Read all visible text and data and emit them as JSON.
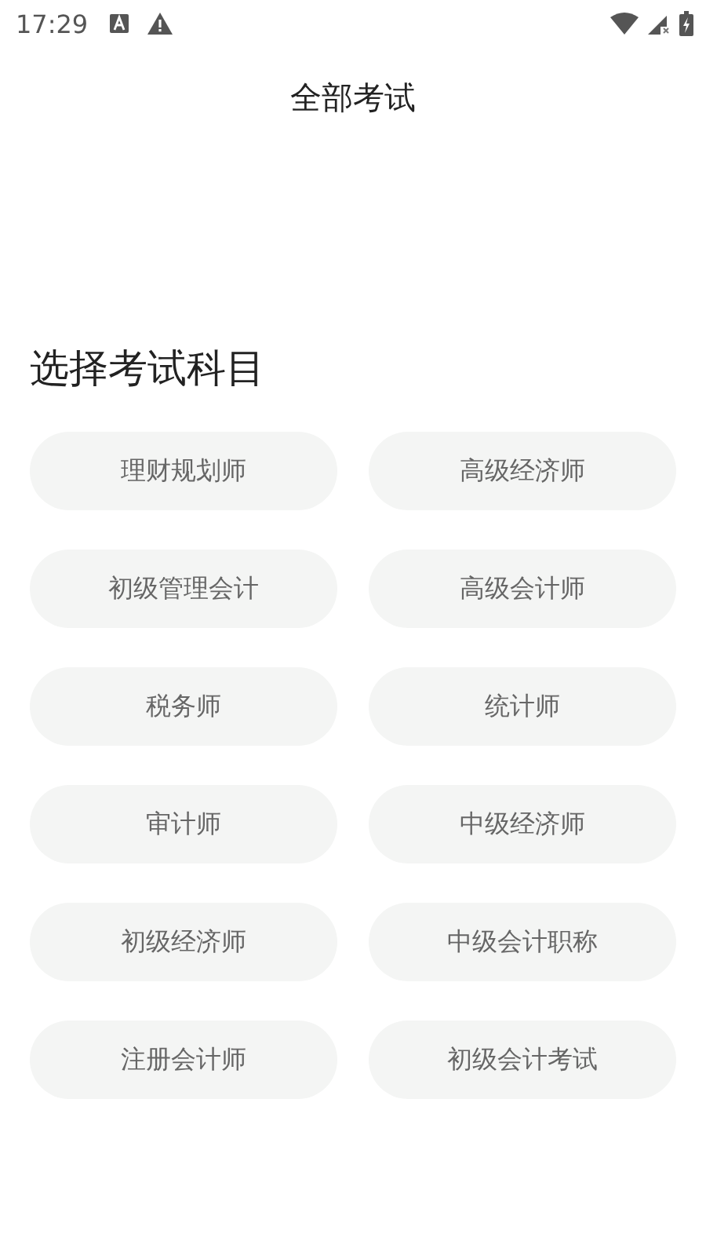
{
  "status_bar": {
    "time": "17:29"
  },
  "header": {
    "title": "全部考试"
  },
  "section": {
    "title": "选择考试科目"
  },
  "subjects": [
    {
      "label": "理财规划师"
    },
    {
      "label": "高级经济师"
    },
    {
      "label": "初级管理会计"
    },
    {
      "label": "高级会计师"
    },
    {
      "label": "税务师"
    },
    {
      "label": "统计师"
    },
    {
      "label": "审计师"
    },
    {
      "label": "中级经济师"
    },
    {
      "label": "初级经济师"
    },
    {
      "label": "中级会计职称"
    },
    {
      "label": "注册会计师"
    },
    {
      "label": "初级会计考试"
    }
  ]
}
